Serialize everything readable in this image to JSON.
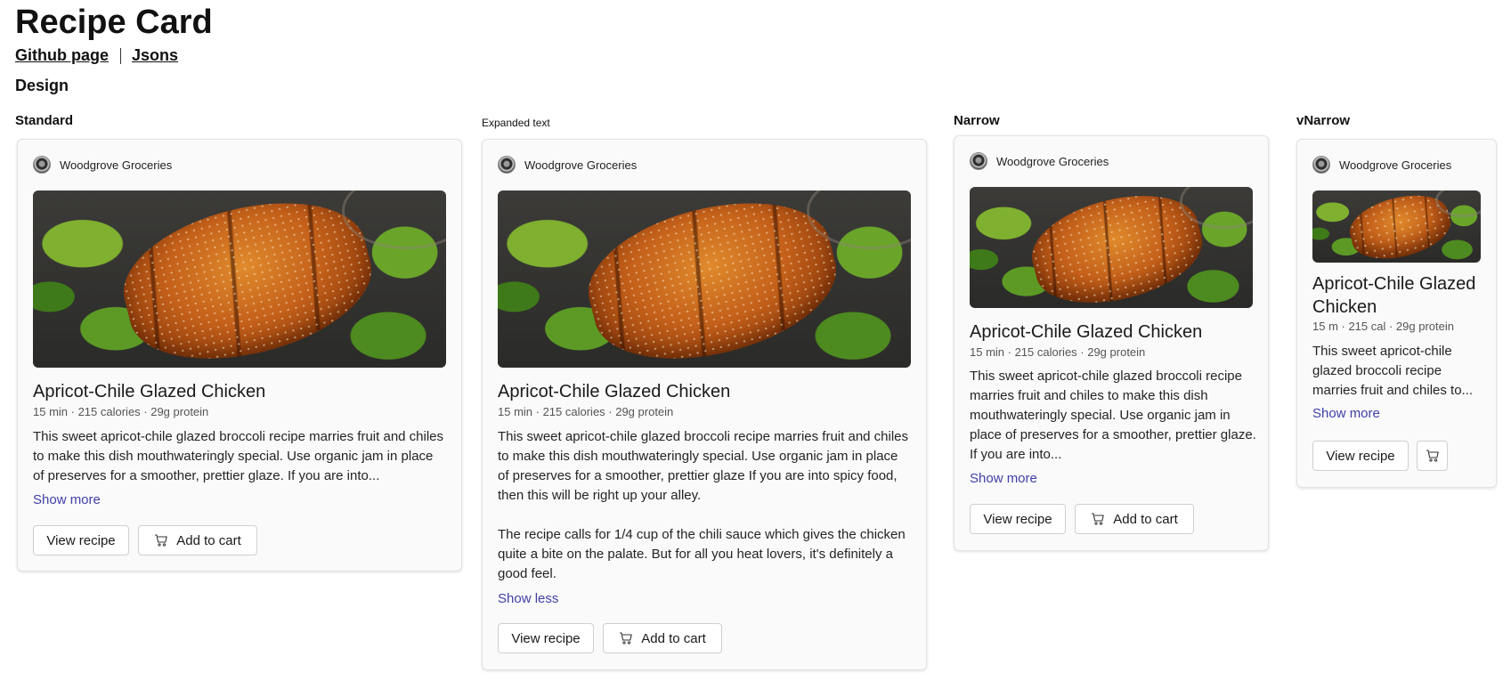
{
  "header": {
    "title": "Recipe Card",
    "links": [
      "Github page",
      "Jsons"
    ],
    "section": "Design"
  },
  "columns": [
    "Standard",
    "Expanded text",
    "Narrow",
    "vNarrow"
  ],
  "card": {
    "brand": "Woodgrove Groceries",
    "title": "Apricot-Chile Glazed Chicken",
    "meta": "15 min · 215 calories · 29g protein",
    "meta_short": "15 m · 215 cal · 29g protein",
    "desc_truncated": "This sweet apricot-chile glazed broccoli recipe marries fruit and chiles to make this dish mouthwateringly special. Use organic jam in place of preserves for a smoother, prettier glaze. If you are into...",
    "desc_full_p1": "This sweet apricot-chile glazed broccoli recipe marries fruit and chiles to make this dish mouthwateringly special. Use organic jam in place of preserves for a smoother, prettier glaze If you are into spicy food, then this will be right up your alley.",
    "desc_full_p2": "The recipe calls for 1/4 cup of the chili sauce which gives the chicken quite a bite on the palate. But for all you heat lovers, it's definitely a good feel.",
    "desc_vnarrow": "This sweet apricot-chile glazed broccoli recipe marries fruit and chiles to...",
    "show_more": "Show more",
    "show_less": "Show less",
    "view_recipe": "View recipe",
    "add_to_cart": "Add to cart"
  },
  "icons": {
    "brand_logo": "brand-logo-icon",
    "cart": "cart-icon"
  },
  "colors": {
    "link": "#3f3fa8",
    "card_bg": "#fafafa"
  }
}
